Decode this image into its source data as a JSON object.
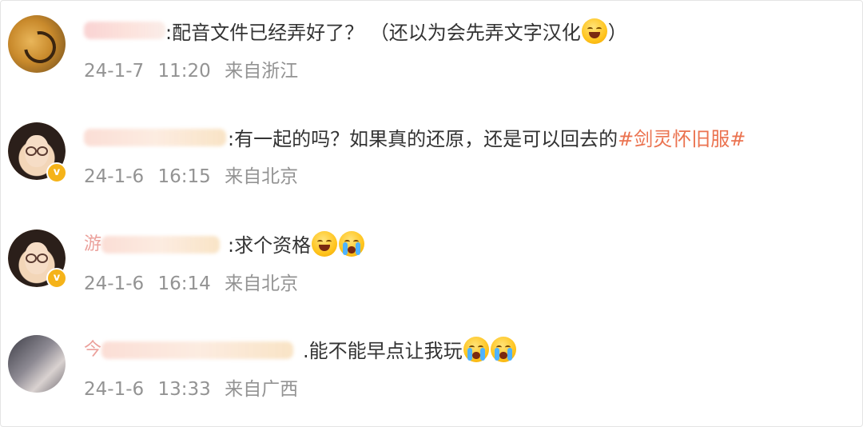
{
  "comments": [
    {
      "name_fragment": "",
      "text": ":配音文件已经弄好了？ （还以为会先弄文字汉化",
      "text_after_emoji": "）",
      "emojis": [
        "laugh-cry-emoji"
      ],
      "date": "24-1-7",
      "time": "11:20",
      "location": "来自浙江",
      "verified": false
    },
    {
      "name_fragment": "",
      "text": ":有一起的吗？如果真的还原，还是可以回去的",
      "hashtag": "#剑灵怀旧服#",
      "emojis": [],
      "date": "24-1-6",
      "time": "16:15",
      "location": "来自北京",
      "verified": true
    },
    {
      "name_fragment": "游",
      "text": ":求个资格",
      "emojis": [
        "sweat-emoji",
        "crying-emoji"
      ],
      "date": "24-1-6",
      "time": "16:14",
      "location": "来自北京",
      "verified": true
    },
    {
      "name_fragment": "今",
      "text": ".能不能早点让我玩",
      "emojis": [
        "crying-emoji",
        "crying-emoji"
      ],
      "date": "24-1-6",
      "time": "13:33",
      "location": "来自广西",
      "verified": false
    }
  ],
  "colors": {
    "text": "#333333",
    "meta": "#939393",
    "hashtag": "#eb7350",
    "badge": "#f5b319"
  }
}
